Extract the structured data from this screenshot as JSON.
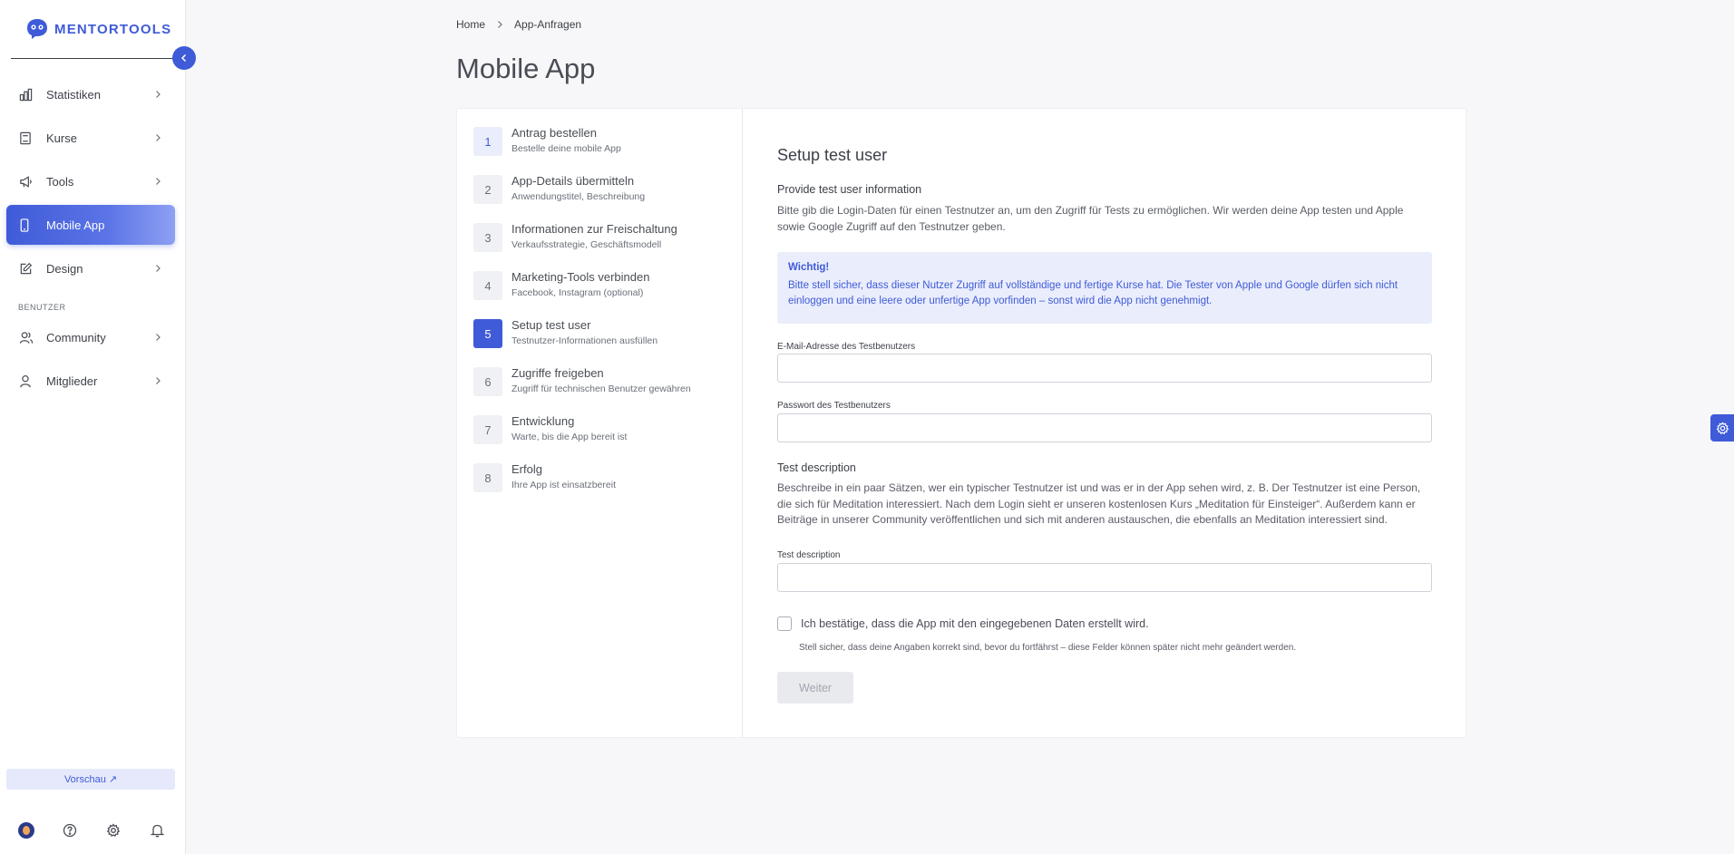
{
  "brand": {
    "name": "MENTORTOOLS",
    "accent": "#3f5bd8"
  },
  "sidebar": {
    "items": [
      {
        "label": "Statistiken",
        "icon": "chart-bar-icon"
      },
      {
        "label": "Kurse",
        "icon": "book-icon"
      },
      {
        "label": "Tools",
        "icon": "megaphone-icon"
      },
      {
        "label": "Mobile App",
        "icon": "smartphone-icon",
        "active": true
      },
      {
        "label": "Design",
        "icon": "edit-icon"
      }
    ],
    "section_label": "BENUTZER",
    "user_items": [
      {
        "label": "Community",
        "icon": "users-icon"
      },
      {
        "label": "Mitglieder",
        "icon": "user-icon"
      }
    ],
    "preview_label": "Vorschau",
    "preview_icon": "↗"
  },
  "breadcrumb": {
    "home": "Home",
    "current": "App-Anfragen"
  },
  "page_title": "Mobile App",
  "steps": [
    {
      "num": "1",
      "title": "Antrag bestellen",
      "sub": "Bestelle deine mobile App"
    },
    {
      "num": "2",
      "title": "App-Details übermitteln",
      "sub": "Anwendungstitel, Beschreibung"
    },
    {
      "num": "3",
      "title": "Informationen zur Freischaltung",
      "sub": "Verkaufsstrategie, Geschäftsmodell"
    },
    {
      "num": "4",
      "title": "Marketing-Tools verbinden",
      "sub": "Facebook, Instagram (optional)"
    },
    {
      "num": "5",
      "title": "Setup test user",
      "sub": "Testnutzer-Informationen ausfüllen"
    },
    {
      "num": "6",
      "title": "Zugriffe freigeben",
      "sub": "Zugriff für technischen Benutzer gewähren"
    },
    {
      "num": "7",
      "title": "Entwicklung",
      "sub": "Warte, bis die App bereit ist"
    },
    {
      "num": "8",
      "title": "Erfolg",
      "sub": "Ihre App ist einsatzbereit"
    }
  ],
  "form": {
    "heading": "Setup test user",
    "info_title": "Provide test user information",
    "info_text": "Bitte gib die Login-Daten für einen Testnutzer an, um den Zugriff für Tests zu ermöglichen. Wir werden deine App testen und Apple sowie Google Zugriff auf den Testnutzer geben.",
    "alert_title": "Wichtig!",
    "alert_text": "Bitte stell sicher, dass dieser Nutzer Zugriff auf vollständige und fertige Kurse hat. Die Tester von Apple und Google dürfen sich nicht einloggen und eine leere oder unfertige App vorfinden – sonst wird die App nicht genehmigt.",
    "email_label": "E-Mail-Adresse des Testbenutzers",
    "email_value": "",
    "password_label": "Passwort des Testbenutzers",
    "password_value": "",
    "desc_title": "Test description",
    "desc_text": "Beschreibe in ein paar Sätzen, wer ein typischer Testnutzer ist und was er in der App sehen wird, z. B. Der Testnutzer ist eine Person, die sich für Meditation interessiert. Nach dem Login sieht er unseren kostenlosen Kurs „Meditation für Einsteiger“. Außerdem kann er Beiträge in unserer Community veröffentlichen und sich mit anderen austauschen, die ebenfalls an Meditation interessiert sind.",
    "desc_label": "Test description",
    "desc_value": "",
    "confirm_label": "Ich bestätige, dass die App mit den eingegebenen Daten erstellt wird.",
    "confirm_hint": "Stell sicher, dass deine Angaben korrekt sind, bevor du fortfährst – diese Felder können später nicht mehr geändert werden.",
    "next_label": "Weiter"
  }
}
